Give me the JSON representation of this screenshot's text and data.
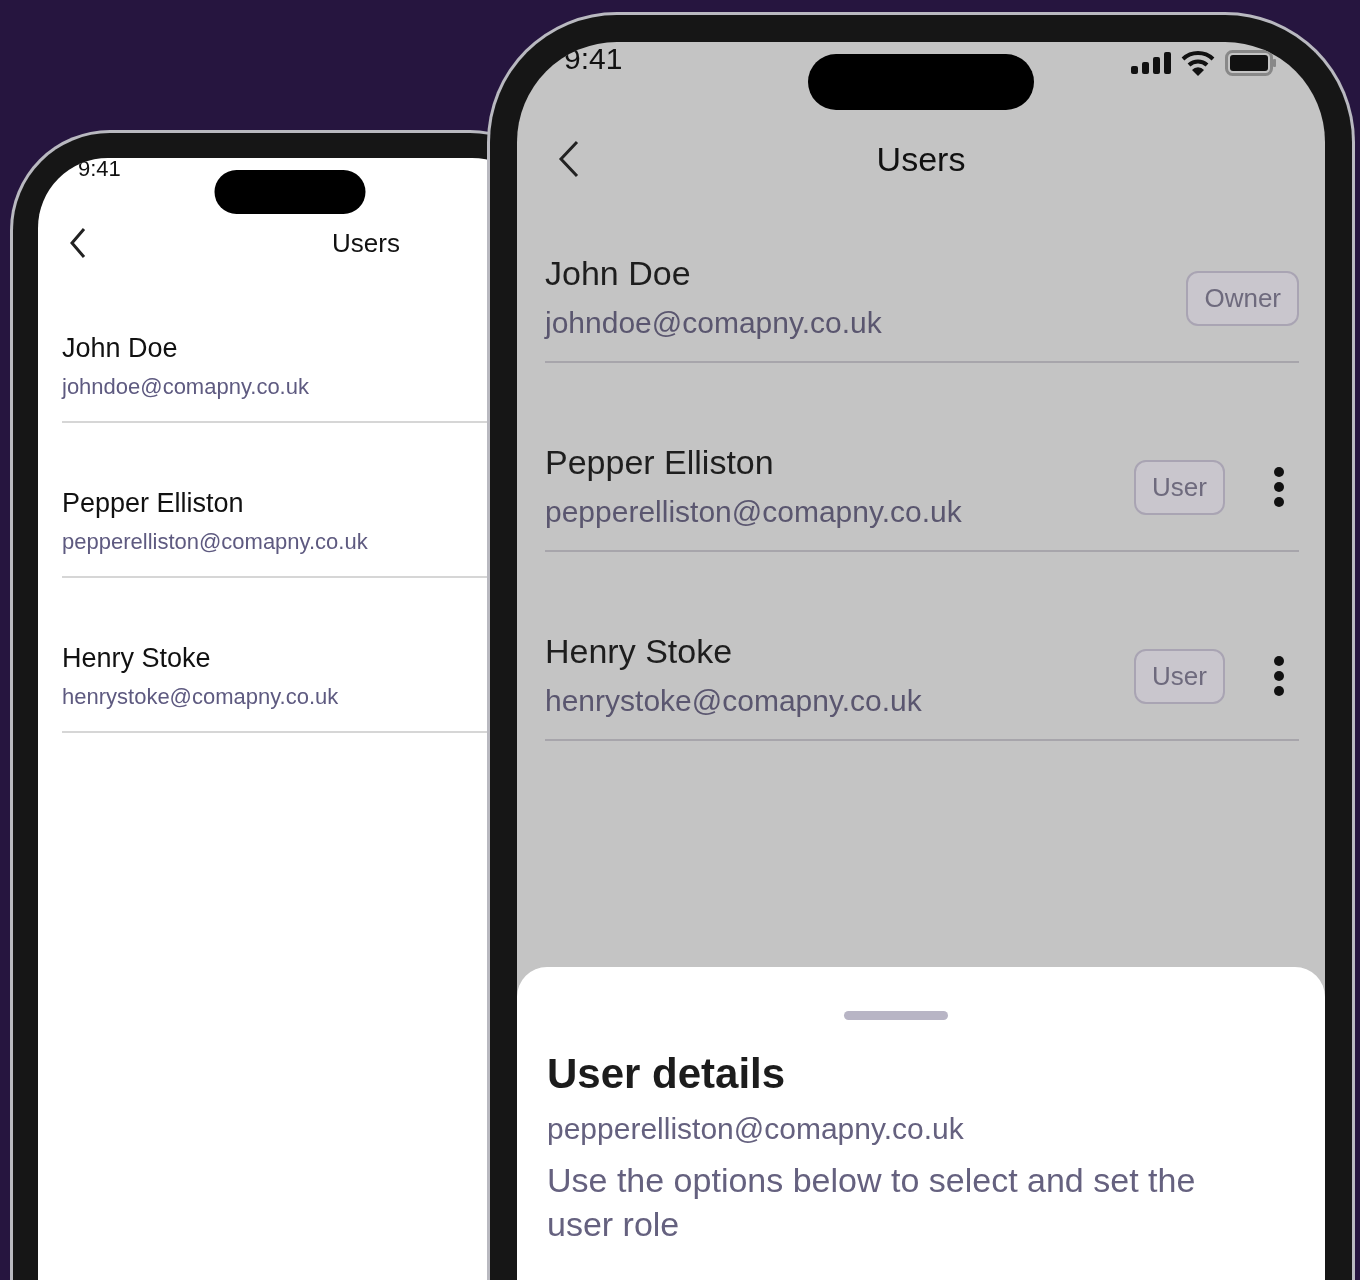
{
  "phones": [
    {
      "status_time": "9:41",
      "title": "Users",
      "users": [
        {
          "name": "John Doe",
          "email": "johndoe@comapny.co.uk"
        },
        {
          "name": "Pepper Elliston",
          "email": "pepperelliston@comapny.co.uk"
        },
        {
          "name": "Henry Stoke",
          "email": "henrystoke@comapny.co.uk"
        }
      ]
    },
    {
      "status_time": "9:41",
      "title": "Users",
      "users": [
        {
          "name": "John Doe",
          "email": "johndoe@comapny.co.uk",
          "role": "Owner",
          "has_menu": false
        },
        {
          "name": "Pepper Elliston",
          "email": "pepperelliston@comapny.co.uk",
          "role": "User",
          "has_menu": true
        },
        {
          "name": "Henry Stoke",
          "email": "henrystoke@comapny.co.uk",
          "role": "User",
          "has_menu": true
        }
      ],
      "sheet": {
        "title": "User details",
        "email": "pepperelliston@comapny.co.uk",
        "description": "Use the options below to select and set the user role"
      }
    }
  ]
}
